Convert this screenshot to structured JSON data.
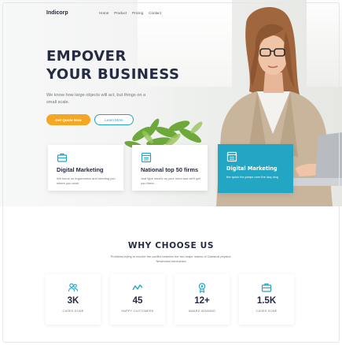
{
  "brand": {
    "name": "Indicorp"
  },
  "nav": {
    "items": [
      "Home",
      "Product",
      "Pricing",
      "Contact"
    ]
  },
  "hero": {
    "title_line1": "EMPOVER",
    "title_line2": "YOUR BUSINESS",
    "subtitle": "We know how large objects will act, but things on a small scale.",
    "primary_button": "Get Quote Now",
    "secondary_button": "Learn More"
  },
  "features": [
    {
      "icon": "briefcase-icon",
      "title": "Digital Marketing",
      "desc": "We focus on ergonomics and meeting you where you work."
    },
    {
      "icon": "browser-icon",
      "title": "National top 50 firms",
      "desc": "Just type what's on your mind and we'll get you there."
    },
    {
      "icon": "browser-icon",
      "title": "Digital Marketing",
      "desc": "the quick fox jumps over the lazy dog"
    }
  ],
  "why": {
    "title": "WHY CHOOSE US",
    "subtitle": "Problems trying to resolve the conflict between the two major realms of Classical physics: Newtonian mechanics"
  },
  "stats": [
    {
      "icon": "users-icon",
      "value": "3K",
      "label": "CASES DONE"
    },
    {
      "icon": "trend-icon",
      "value": "45",
      "label": "HAPPY CUSTOMERS"
    },
    {
      "icon": "award-icon",
      "value": "12+",
      "label": "AWARD WINNING"
    },
    {
      "icon": "briefcase-icon",
      "value": "1.5K",
      "label": "CASES DONE"
    }
  ],
  "colors": {
    "accent": "#23a6c3",
    "orange": "#f5a623",
    "dark": "#252b42",
    "muted": "#737373"
  }
}
